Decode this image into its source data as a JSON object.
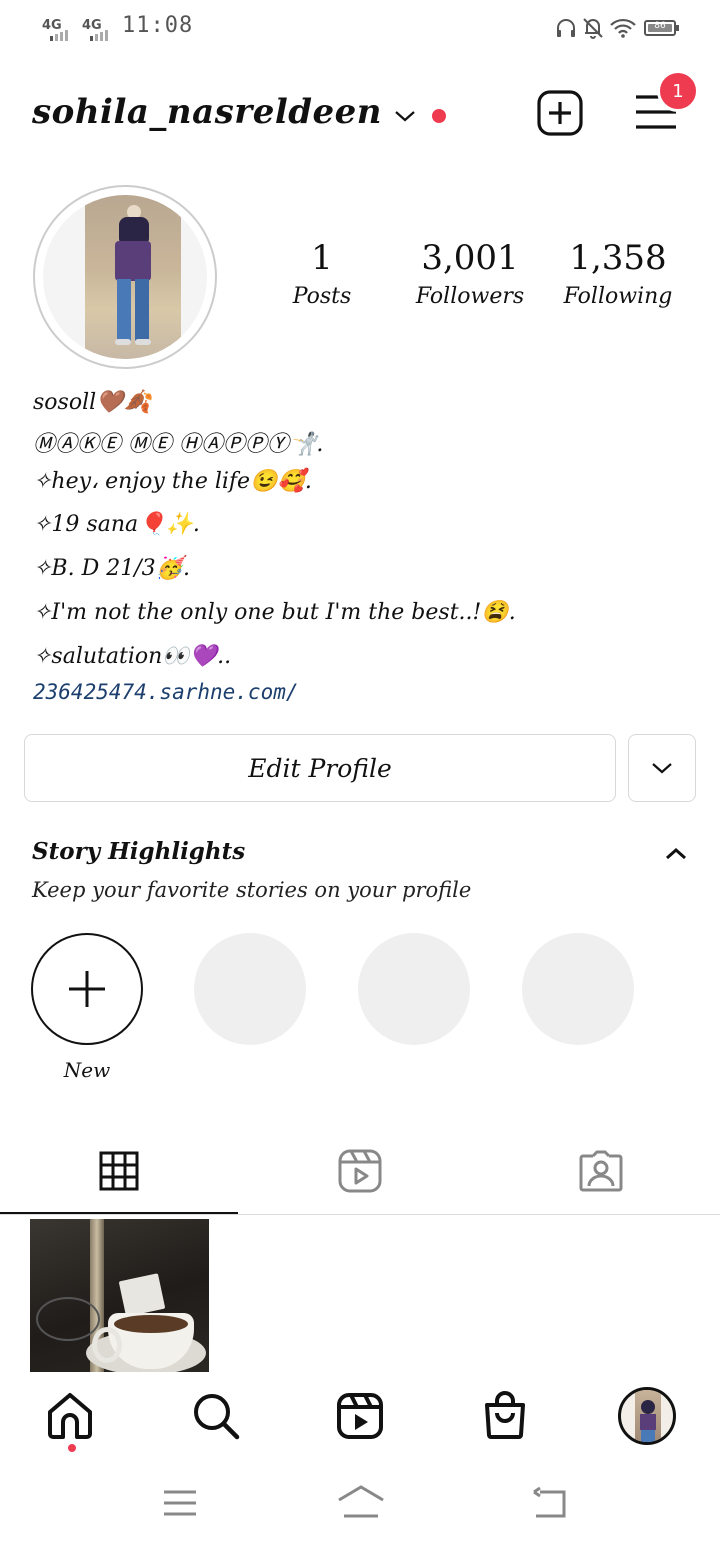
{
  "status_bar": {
    "net1": "4G",
    "net2": "4G",
    "time": "11:08",
    "battery": "86"
  },
  "header": {
    "username": "sohila_nasreldeen",
    "menu_badge": "1"
  },
  "stats": [
    {
      "value": "1",
      "label": "Posts"
    },
    {
      "value": "3,001",
      "label": "Followers"
    },
    {
      "value": "1,358",
      "label": "Following"
    }
  ],
  "bio": {
    "name": "sosoll🤎🍂",
    "lines": [
      "ⓂⒶⓀⒺ ⓂⒺ ⒽⒶⓅⓅⓎ🤺.",
      "✧hey، enjoy the life😉🥰.",
      "✧19 sana🎈✨.",
      "✧B. D 21/3🥳.",
      "✧I'm not the only one but I'm the best..!😫.",
      "✧salutation👀💜.."
    ],
    "link": "236425474.sarhne.com/"
  },
  "buttons": {
    "edit_profile": "Edit Profile"
  },
  "highlights": {
    "title": "Story Highlights",
    "subtitle": "Keep your favorite stories on your profile",
    "new_label": "New"
  },
  "icons": {
    "new_post": "plus-square-icon",
    "menu": "hamburger-menu-icon",
    "grid": "grid-icon",
    "reels": "reels-icon",
    "tagged": "tagged-person-icon",
    "home": "home-icon",
    "search": "search-icon",
    "shop": "shopping-bag-icon"
  },
  "colors": {
    "accent_red": "#ef3b4f",
    "link_blue": "#1c3f6e",
    "divider": "#dbdbdb"
  }
}
